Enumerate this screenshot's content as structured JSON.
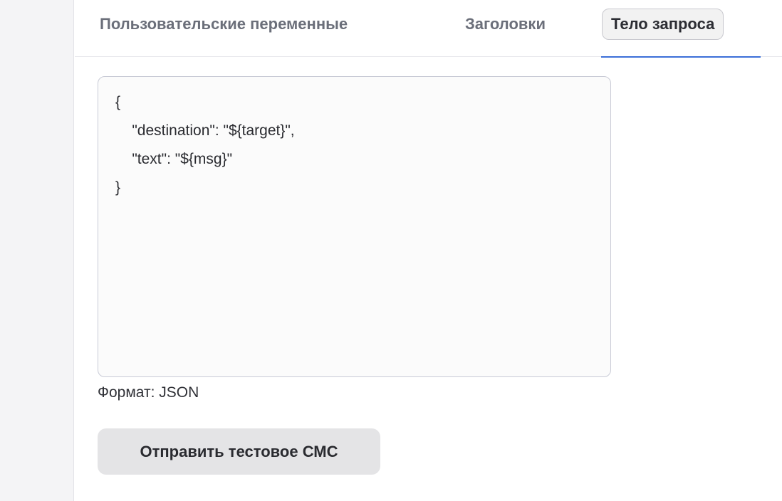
{
  "tabs": [
    {
      "label": "Пользовательские переменные",
      "active": false
    },
    {
      "label": "Заголовки",
      "active": false
    },
    {
      "label": "Тело запроса",
      "active": true
    }
  ],
  "request_body": {
    "value": "{\n    \"destination\": \"${target}\",\n    \"text\": \"${msg}\"\n}",
    "format_hint": "Формат: JSON"
  },
  "actions": {
    "send_test_sms_label": "Отправить тестовое СМС"
  },
  "colors": {
    "accent": "#3b6fd8",
    "active_tab_bg": "#f2f2f2",
    "button_bg": "#e4e4e6"
  }
}
